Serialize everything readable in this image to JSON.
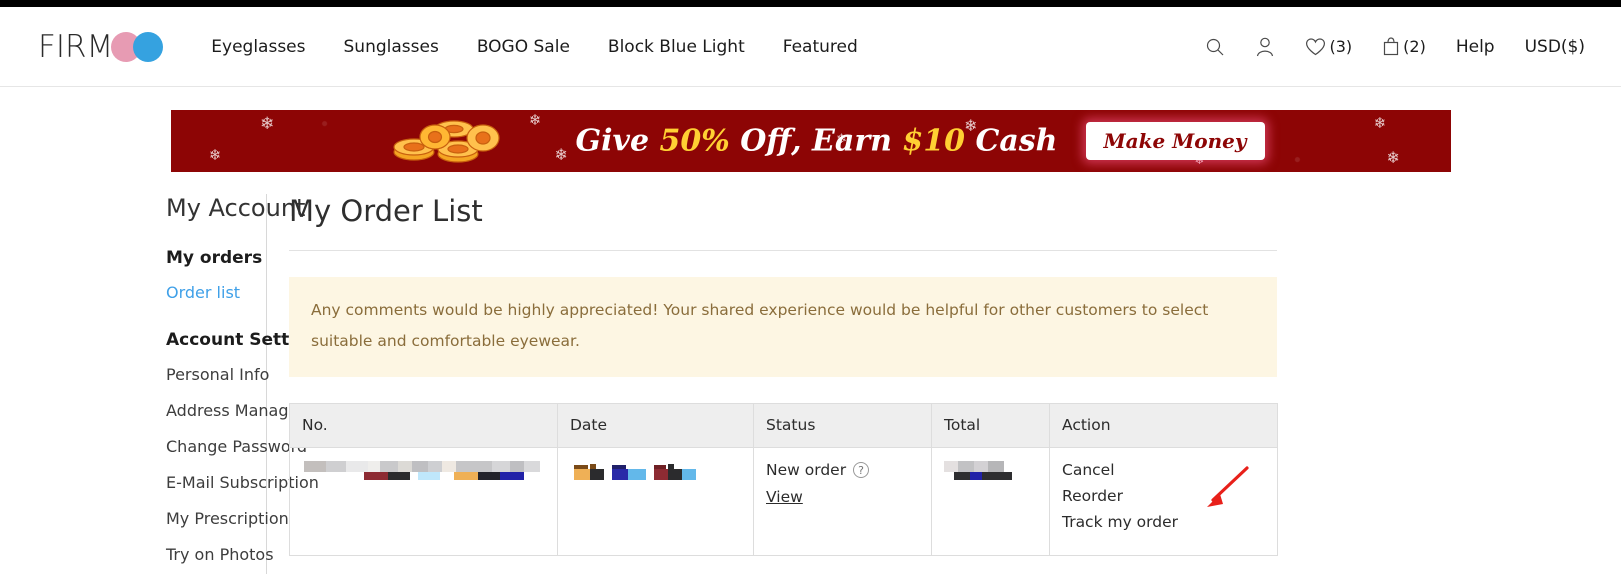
{
  "header": {
    "logo_text": "FIRM",
    "logo_circle_pink": "#e79bb3",
    "logo_circle_blue": "#35a2e0",
    "nav": [
      {
        "label": "Eyeglasses"
      },
      {
        "label": "Sunglasses"
      },
      {
        "label": "BOGO Sale"
      },
      {
        "label": "Block Blue Light"
      },
      {
        "label": "Featured"
      }
    ],
    "right": {
      "search_icon": "search-icon",
      "account_icon": "user-icon",
      "wishlist_icon": "heart-icon",
      "wishlist_count": "(3)",
      "cart_icon": "bag-icon",
      "cart_count": "(2)",
      "help_label": "Help",
      "currency_label": "USD($)"
    }
  },
  "banner": {
    "text_give": "Give ",
    "text_percent": "50%",
    "text_off": " Off, Earn ",
    "text_amount": "$10",
    "text_cash": " Cash",
    "button_label": "Make Money",
    "bg_color": "#8d0505",
    "highlight_color": "#ffd033"
  },
  "sidebar": {
    "title": "My Account",
    "orders_heading": "My orders",
    "order_list_link": "Order list",
    "settings_heading": "Account Settings",
    "settings_items": [
      {
        "label": "Personal Info"
      },
      {
        "label": "Address Management"
      },
      {
        "label": "Change Password"
      },
      {
        "label": "E-Mail Subscription"
      },
      {
        "label": "My Prescription"
      },
      {
        "label": "Try on Photos"
      }
    ]
  },
  "main": {
    "page_title": "My Order List",
    "notice": "Any comments would be highly appreciated! Your shared experience would be helpful for other customers to select suitable and comfortable eyewear.",
    "notice_bg": "#fdf6e3",
    "notice_color": "#8a6d3b",
    "table": {
      "columns": [
        "No.",
        "Date",
        "Status",
        "Total",
        "Action"
      ],
      "rows": [
        {
          "no": "",
          "date": "",
          "status": "New order",
          "status_help_icon": "question-mark-icon",
          "view_label": "View",
          "total": "",
          "actions": [
            "Cancel",
            "Reorder",
            "Track my order"
          ]
        }
      ]
    },
    "annotation": {
      "arrow_color": "#e8201a",
      "points_to": "Track my order"
    }
  }
}
